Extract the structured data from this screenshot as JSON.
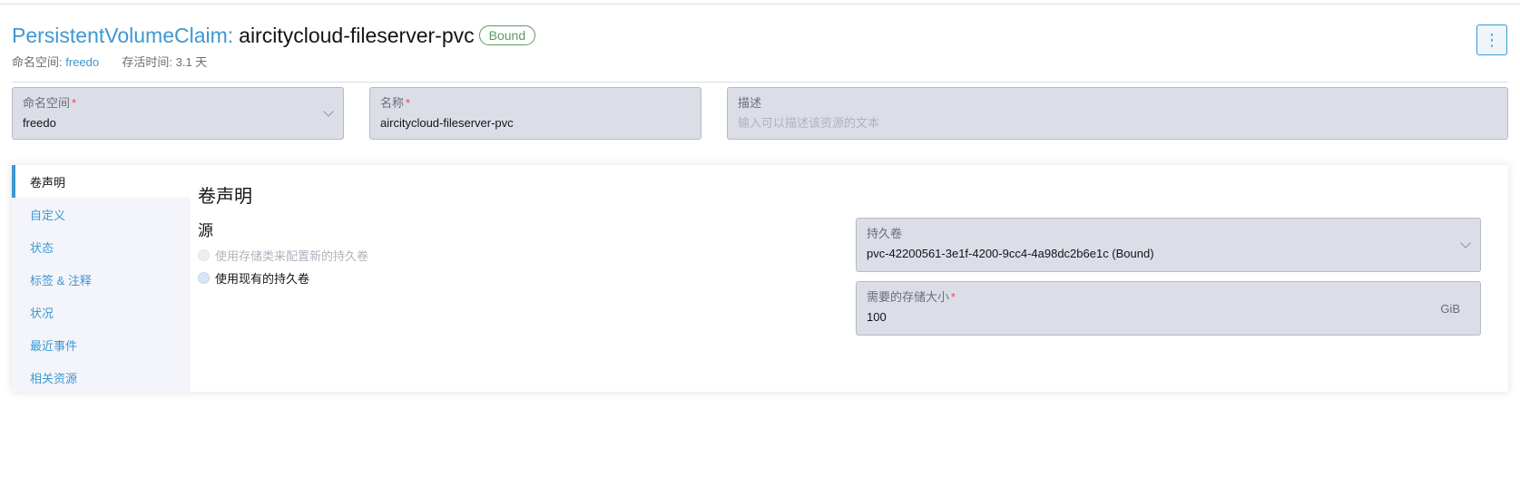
{
  "header": {
    "type_label": "PersistentVolumeClaim:",
    "name": "aircitycloud-fileserver-pvc",
    "status_badge": "Bound",
    "namespace_label": "命名空间:",
    "namespace_value": "freedo",
    "age_label": "存活时间:",
    "age_value": "3.1 天",
    "menu_glyph": "⋮"
  },
  "form": {
    "namespace": {
      "label": "命名空间",
      "required_mark": "*",
      "value": "freedo"
    },
    "name": {
      "label": "名称",
      "required_mark": "*",
      "value": "aircitycloud-fileserver-pvc"
    },
    "description": {
      "label": "描述",
      "placeholder": "输入可以描述该资源的文本"
    }
  },
  "tabs": [
    {
      "label": "卷声明",
      "active": true
    },
    {
      "label": "自定义"
    },
    {
      "label": "状态"
    },
    {
      "label": "标签 & 注释"
    },
    {
      "label": "状况"
    },
    {
      "label": "最近事件"
    },
    {
      "label": "相关资源"
    }
  ],
  "section": {
    "title": "卷声明",
    "source_title": "源",
    "options": [
      {
        "label": "使用存储类来配置新的持久卷",
        "disabled": true,
        "checked": false
      },
      {
        "label": "使用现有的持久卷",
        "disabled": false,
        "checked": true
      }
    ],
    "persistent_volume": {
      "label": "持久卷",
      "value": "pvc-42200561-3e1f-4200-9cc4-4a98dc2b6e1c (Bound)"
    },
    "storage_size": {
      "label": "需要的存储大小",
      "required_mark": "*",
      "value": "100",
      "unit": "GiB"
    }
  },
  "colors": {
    "accent": "#3d98d3",
    "success": "#5d995d",
    "required": "#f64747",
    "field_bg": "#dcdee7"
  }
}
